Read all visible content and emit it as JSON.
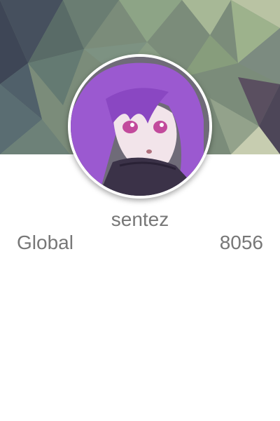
{
  "profile": {
    "username": "sentez",
    "avatar_description": "anime-avatar",
    "stats": {
      "label": "Global",
      "value": "8056"
    }
  },
  "colors": {
    "text": "#777777",
    "background": "#ffffff",
    "avatar_accent": "#9b59d0"
  }
}
